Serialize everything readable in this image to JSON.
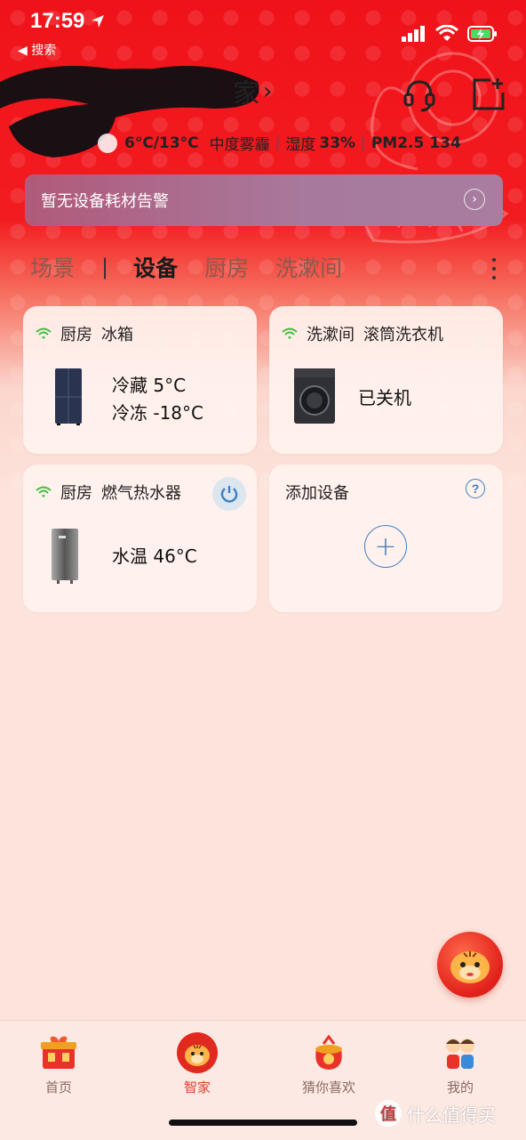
{
  "status_bar": {
    "time": "17:59",
    "back_app": "◀ 搜索"
  },
  "header": {
    "home_name_suffix": "家",
    "weather": {
      "temp": "6°C/13°C",
      "condition": "中度雾霾",
      "humidity_label": "湿度",
      "humidity_value": "33%",
      "pm_label": "PM2.5",
      "pm_value": "134"
    },
    "alert_text": "暂无设备耗材告警"
  },
  "tabs": [
    {
      "label": "场景"
    },
    {
      "label": "设备"
    },
    {
      "label": "厨房"
    },
    {
      "label": "洗漱间"
    }
  ],
  "devices": [
    {
      "room": "厨房",
      "name": "冰箱",
      "line1": "冷藏 5°C",
      "line2": "冷冻 -18°C"
    },
    {
      "room": "洗漱间",
      "name": "滚筒洗衣机",
      "status": "已关机"
    },
    {
      "room": "厨房",
      "name": "燃气热水器",
      "reading": "水温 46°C"
    }
  ],
  "add_device": {
    "label": "添加设备",
    "help_icon": "?",
    "plus_icon": "+"
  },
  "nav": [
    {
      "label": "首页",
      "icon": "gift-box-icon"
    },
    {
      "label": "智家",
      "icon": "tiger-icon",
      "active": true
    },
    {
      "label": "猜你喜欢",
      "icon": "lucky-bag-icon"
    },
    {
      "label": "我的",
      "icon": "kids-icon"
    }
  ],
  "watermark": {
    "badge": "值",
    "text": "什么值得买"
  },
  "colors": {
    "banner_red": "#f0121a",
    "accent_blue": "#3e7fc0",
    "nav_active": "#e04030",
    "wifi_green": "#3fbf3f"
  }
}
